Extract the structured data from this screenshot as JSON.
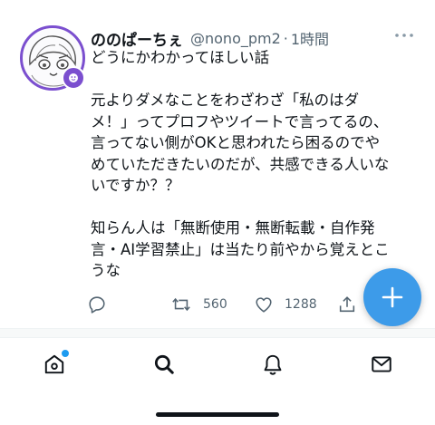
{
  "tweet": {
    "display_name": "ののぱーちぇ",
    "handle": "@nono_pm2",
    "separator": "·",
    "time": "1時間",
    "body": "どうにかわかってほしい話\n\n元よりダメなことをわざわざ「私のはダメ！」ってプロフやツイートで言ってるの、言ってない側がOKと思われたら困るのでやめていただきたいのだが、共感できる人いないですか？？\n\n知らん人は「無断使用・無断転載・自作発言・AI学習禁止」は当たり前やから覚えとこうな",
    "retweet_count": "560",
    "like_count": "1288"
  },
  "icons": {
    "more": "more-horizontal-icon",
    "reply": "reply-icon",
    "retweet": "retweet-icon",
    "like": "heart-icon",
    "share": "share-icon",
    "compose": "compose-plus-icon",
    "home": "home-icon",
    "search": "search-icon",
    "notifications": "bell-icon",
    "messages": "mail-icon"
  },
  "colors": {
    "accent": "#3d9be9",
    "notification_dot": "#1d9bf0",
    "avatar_ring": "#7b4fcf",
    "secondary_text": "#536471"
  }
}
